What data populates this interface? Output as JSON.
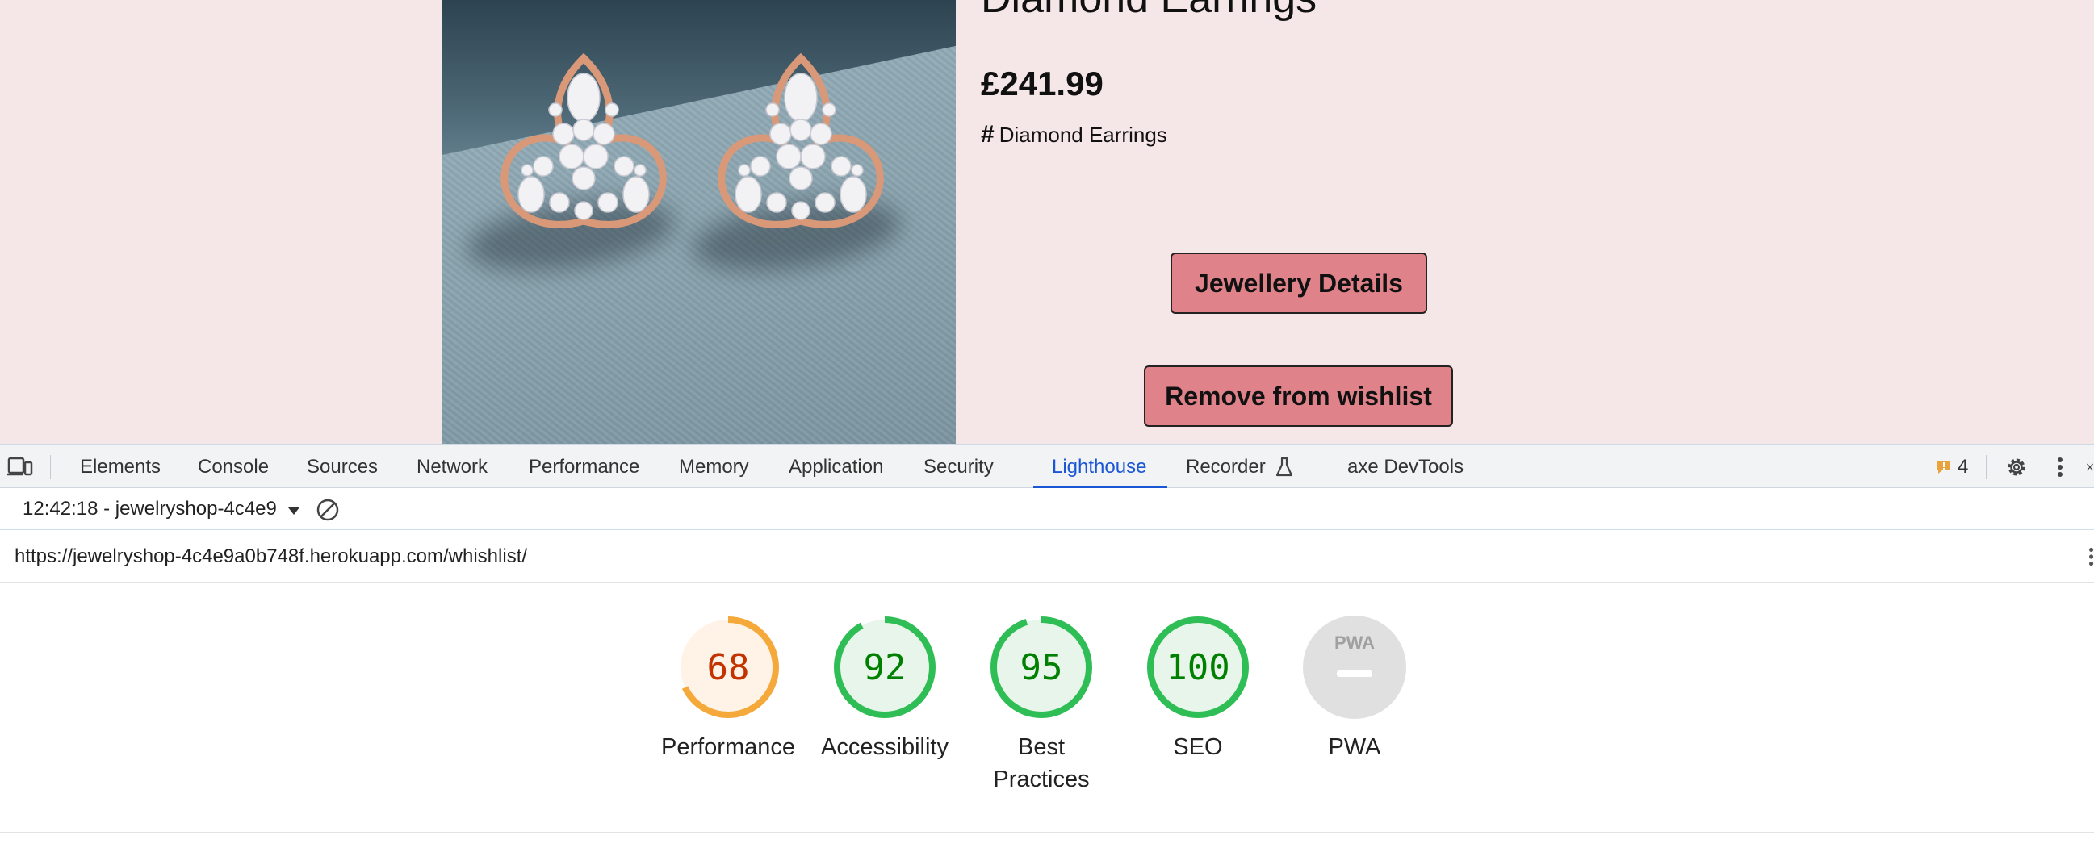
{
  "product": {
    "title": "Diamond Earrings",
    "price": "£241.99",
    "category": "Diamond Earrings",
    "category_symbol": "#",
    "details_button": "Jewellery Details",
    "remove_button": "Remove from wishlist"
  },
  "devtools": {
    "tabs": [
      {
        "label": "Elements"
      },
      {
        "label": "Console"
      },
      {
        "label": "Sources"
      },
      {
        "label": "Network"
      },
      {
        "label": "Performance"
      },
      {
        "label": "Memory"
      },
      {
        "label": "Application"
      },
      {
        "label": "Security"
      },
      {
        "label": "Lighthouse",
        "active": true
      },
      {
        "label": "Recorder"
      },
      {
        "label": "axe DevTools"
      }
    ],
    "issues_count": "4",
    "report_selector": "12:42:18 - jewelryshop-4c4e9",
    "url": "https://jewelryshop-4c4e9a0b748f.herokuapp.com/whishlist/",
    "icons": [
      "device-toggle-icon",
      "flask-icon",
      "issues-flag-icon",
      "gear-icon",
      "kebab-menu-icon",
      "clear-icon",
      "dropdown-arrow-icon"
    ]
  },
  "lighthouse": {
    "scores": [
      {
        "label": "Performance",
        "value": 68,
        "display": "68",
        "status": "average"
      },
      {
        "label": "Accessibility",
        "value": 92,
        "display": "92",
        "status": "pass"
      },
      {
        "label": "Best Practices",
        "label_line1": "Best",
        "label_line2": "Practices",
        "value": 95,
        "display": "95",
        "status": "pass"
      },
      {
        "label": "SEO",
        "value": 100,
        "display": "100",
        "status": "pass"
      },
      {
        "label": "PWA",
        "badge": "PWA",
        "status": "na"
      }
    ],
    "colors": {
      "average_ring": "#f4a93a",
      "average_fill": "#fff3e8",
      "average_text": "#c33300",
      "pass_ring": "#2fbe55",
      "pass_fill": "#e8f5ea",
      "pass_text": "#008000",
      "na_fill": "#e0e0e0"
    }
  }
}
